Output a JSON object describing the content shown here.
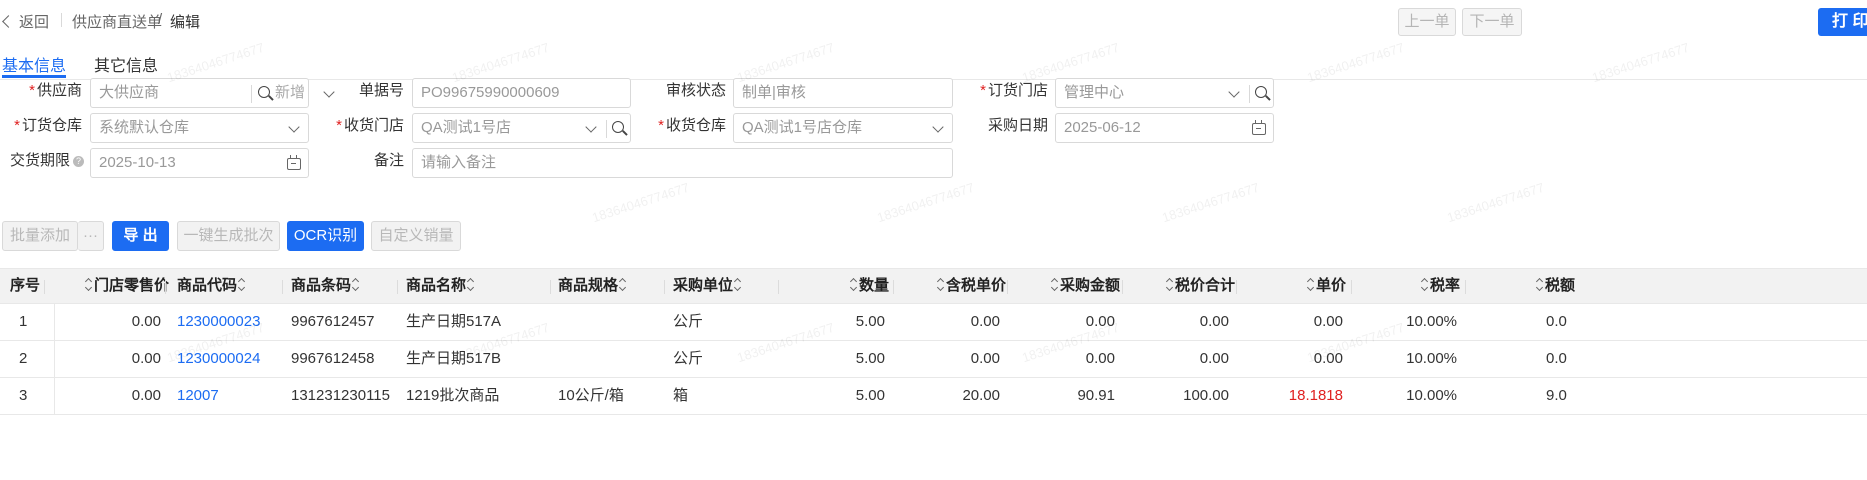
{
  "topbar": {
    "back_label": "返回",
    "breadcrumb_parent": "供应商直送单",
    "breadcrumb_sep": "/",
    "breadcrumb_current": "编辑",
    "prev_label": "上一单",
    "next_label": "下一单",
    "print_label": "打 印"
  },
  "tabs": [
    {
      "label": "基本信息",
      "active": true
    },
    {
      "label": "其它信息",
      "active": false
    }
  ],
  "form": {
    "supplier": {
      "label": "供应商",
      "required": true,
      "value": "大供应商",
      "add_label": "新增"
    },
    "doc_no": {
      "label": "单据号",
      "value": "PO99675990000609"
    },
    "audit_status": {
      "label": "审核状态",
      "value": "制单|审核"
    },
    "order_store": {
      "label": "订货门店",
      "required": true,
      "value": "管理中心"
    },
    "order_warehouse": {
      "label": "订货仓库",
      "required": true,
      "value": "系统默认仓库"
    },
    "receive_store": {
      "label": "收货门店",
      "required": true,
      "value": "QA测试1号店"
    },
    "receive_warehouse": {
      "label": "收货仓库",
      "required": true,
      "value": "QA测试1号店仓库"
    },
    "purchase_date": {
      "label": "采购日期",
      "value": "2025-06-12"
    },
    "delivery_deadline": {
      "label": "交货期限",
      "value": "2025-10-13",
      "help_icon": "question-circle-icon"
    },
    "remark": {
      "label": "备注",
      "placeholder": "请输入备注"
    }
  },
  "actions": {
    "batch_add": "批量添加",
    "more": "···",
    "export": "导 出",
    "gen_batch": "一键生成批次",
    "ocr": "OCR识别",
    "custom_sales": "自定义销量"
  },
  "table": {
    "headers": [
      "序号",
      "门店零售价",
      "商品代码",
      "商品条码",
      "商品名称",
      "商品规格",
      "采购单位",
      "数量",
      "含税单价",
      "采购金额",
      "税价合计",
      "单价",
      "税率",
      "税额"
    ],
    "rows": [
      {
        "idx": "1",
        "retail_price": "0.00",
        "code": "1230000023",
        "barcode": "9967612457",
        "name": "生产日期517A",
        "spec": "",
        "unit": "公斤",
        "qty": "5.00",
        "tax_price": "0.00",
        "amount": "0.00",
        "total": "0.00",
        "unit_price": "0.00",
        "tax_rate": "10.00%",
        "tax": "0.0"
      },
      {
        "idx": "2",
        "retail_price": "0.00",
        "code": "1230000024",
        "barcode": "9967612458",
        "name": "生产日期517B",
        "spec": "",
        "unit": "公斤",
        "qty": "5.00",
        "tax_price": "0.00",
        "amount": "0.00",
        "total": "0.00",
        "unit_price": "0.00",
        "tax_rate": "10.00%",
        "tax": "0.0"
      },
      {
        "idx": "3",
        "retail_price": "0.00",
        "code": "12007",
        "barcode": "131231230115",
        "name": "1219批次商品",
        "spec": "10公斤/箱",
        "unit": "箱",
        "qty": "5.00",
        "tax_price": "20.00",
        "amount": "90.91",
        "total": "100.00",
        "unit_price": "18.1818",
        "tax_rate": "10.00%",
        "tax": "9.0"
      }
    ]
  },
  "watermark": "18364046774677",
  "colors": {
    "primary": "#1c6cf2",
    "required": "#e02020",
    "negative_price": "#e02020"
  }
}
